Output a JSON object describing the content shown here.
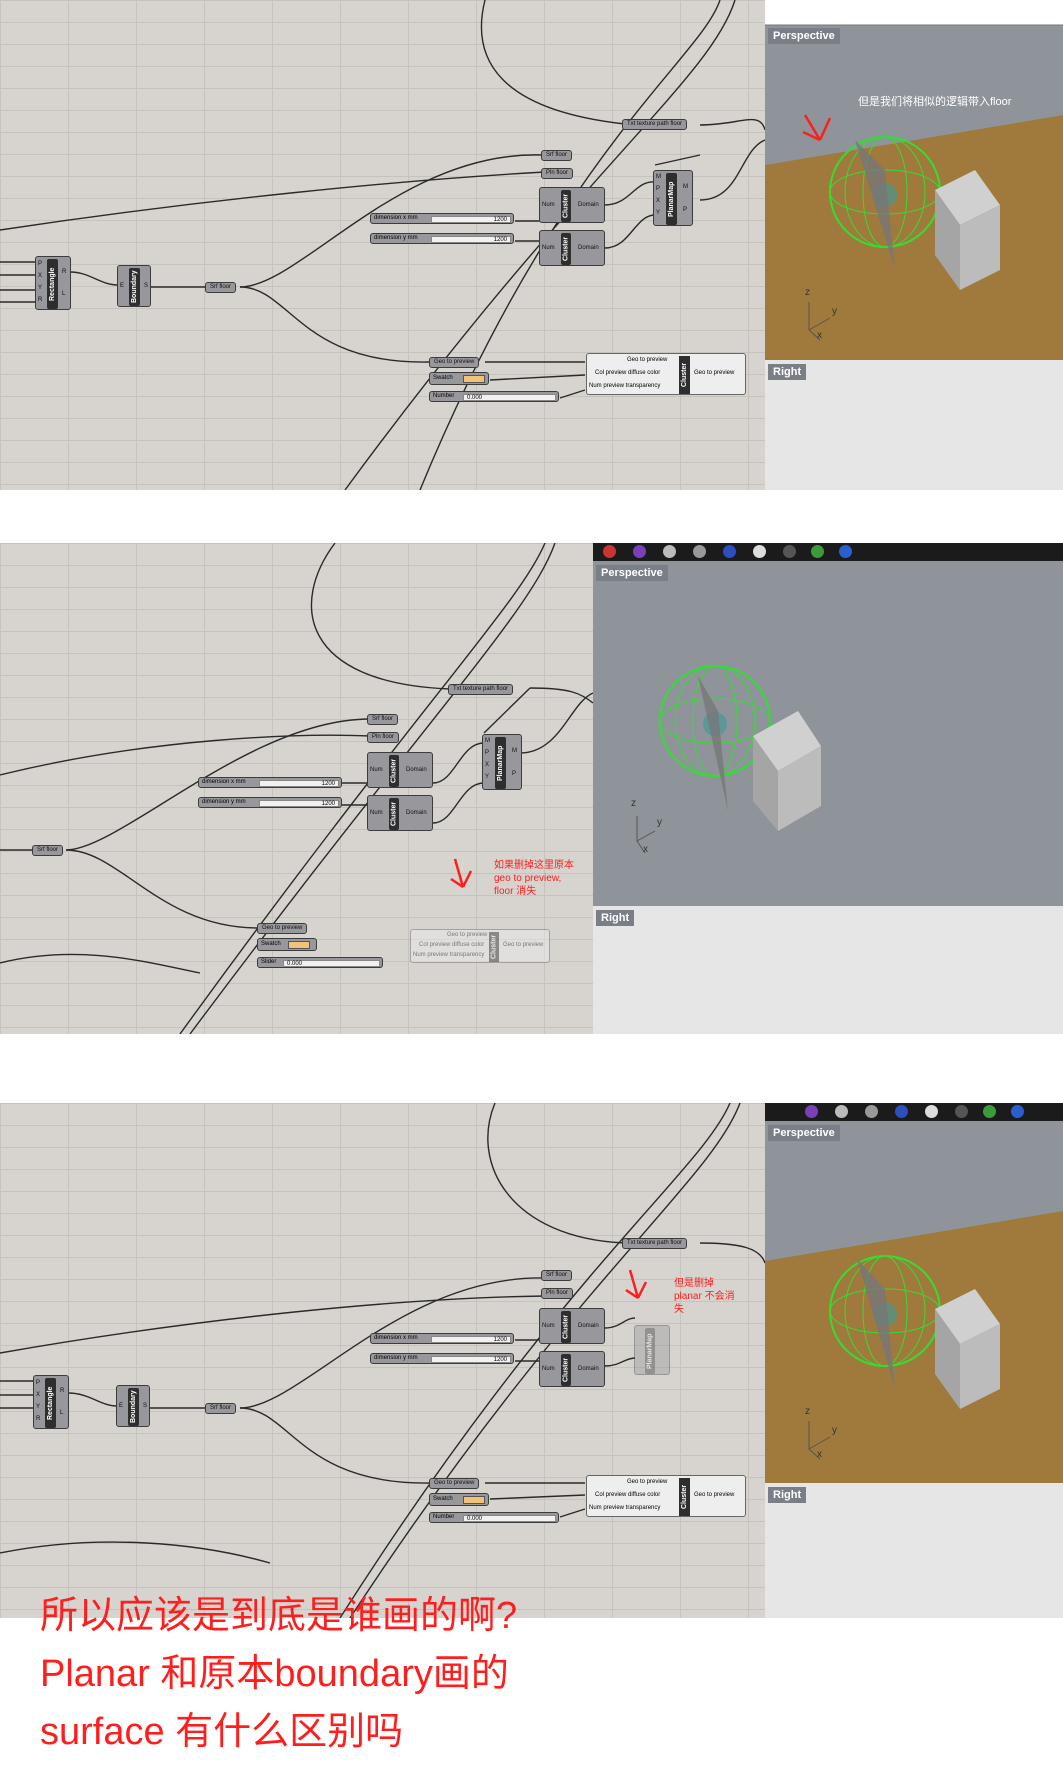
{
  "panel1": {
    "perspective_label": "Perspective",
    "right_label": "Right",
    "note": "但是我们将相似的逻辑带入floor",
    "txt_texture": "Txt texture path floor",
    "srf_floor": "Srf floor",
    "pln_floor": "Pln floor",
    "dim_x": "dimension x mm",
    "dim_y": "dimension y mm",
    "dim_x_val": "1200",
    "dim_y_val": "1200",
    "rectangle": "Rectangle",
    "boundary": "Boundary",
    "srf_floor2": "Srf floor",
    "cluster": "Cluster",
    "planarmap": "PlanarMap",
    "geo_to_preview": "Geo to preview",
    "swatch": "Swatch",
    "number": "Number",
    "number_val": "0.000",
    "col_preview": "Col preview diffuse color",
    "num_transp": "Num preview transparency",
    "geo_out": "Geo to preview",
    "domain": "Domain",
    "num": "Num"
  },
  "panel2": {
    "perspective_label": "Perspective",
    "right_label": "Right",
    "note": "如果删掉这里原本\ngeo to preview,\nfloor 消失",
    "txt_texture": "Txt texture path floor",
    "srf_floor": "Srf floor",
    "pln_floor": "Pln floor",
    "dim_x": "dimension x mm",
    "dim_y": "dimension y mm",
    "dim_val": "1200",
    "srf_floor2": "Srf floor",
    "cluster": "Cluster",
    "planarmap": "PlanarMap",
    "geo_to_preview": "Geo to preview",
    "swatch": "Swatch",
    "slider": "Slider",
    "slider_val": "0.000",
    "col_preview": "Col preview diffuse color",
    "num_transp": "Num preview transparency",
    "geo_out": "Geo to preview",
    "domain": "Domain",
    "num": "Num"
  },
  "panel3": {
    "perspective_label": "Perspective",
    "right_label": "Right",
    "note": "但是删掉\nplanar 不会消\n失",
    "txt_texture": "Txt texture path floor",
    "srf_floor": "Srf floor",
    "pln_floor": "Pln floor",
    "dim_x": "dimension x mm",
    "dim_y": "dimension y mm",
    "dim_val": "1200",
    "rectangle": "Rectangle",
    "boundary": "Boundary",
    "srf_floor2": "Srf floor",
    "cluster": "Cluster",
    "planarmap": "PlanarMap",
    "geo_to_preview": "Geo to preview",
    "swatch": "Swatch",
    "number": "Number",
    "number_val": "0.000",
    "col_preview": "Col preview diffuse color",
    "num_transp": "Num preview transparency",
    "geo_out": "Geo to preview",
    "domain": "Domain",
    "num": "Num"
  },
  "question": {
    "line1": "所以应该是到底是谁画的啊?",
    "line2": "Planar 和原本boundary画的",
    "line3": "surface 有什么区别吗"
  },
  "axes": {
    "z": "z",
    "y": "y",
    "x": "x"
  },
  "colors": {
    "annotation": "#ff1e1e",
    "floor": "#a07a3c",
    "sphere": "#33dd33",
    "swatch": "#f0c27a"
  }
}
